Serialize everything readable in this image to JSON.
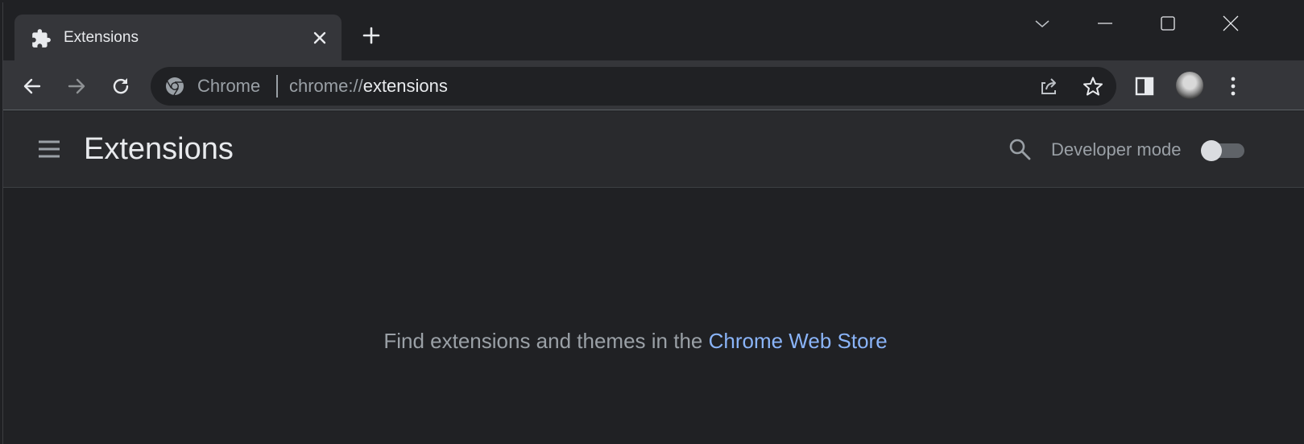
{
  "tab": {
    "title": "Extensions",
    "favicon": "puzzle-piece-icon",
    "close_icon": "close-icon"
  },
  "tabstrip": {
    "new_tab_icon": "plus-icon",
    "tab_search_icon": "chevron-down-icon",
    "minimize_icon": "minimize-icon",
    "maximize_icon": "maximize-icon",
    "close_window_icon": "close-icon"
  },
  "toolbar": {
    "back_icon": "arrow-left-icon",
    "forward_icon": "arrow-right-icon",
    "reload_icon": "reload-icon",
    "omnibox": {
      "chip_label": "Chrome",
      "url_scheme": "chrome://",
      "url_host": "extensions"
    },
    "share_icon": "share-icon",
    "bookmark_icon": "star-icon",
    "side_panel_icon": "side-panel-icon",
    "menu_icon": "kebab-menu-icon"
  },
  "extensions_header": {
    "title": "Extensions",
    "developer_mode_label": "Developer mode",
    "developer_mode_on": false
  },
  "main": {
    "empty_text": "Find extensions and themes in the ",
    "store_link": "Chrome Web Store"
  },
  "colors": {
    "background": "#202124",
    "toolbar": "#35363a",
    "header": "#292a2d",
    "link": "#8ab4f8",
    "muted_text": "#9aa0a6"
  }
}
